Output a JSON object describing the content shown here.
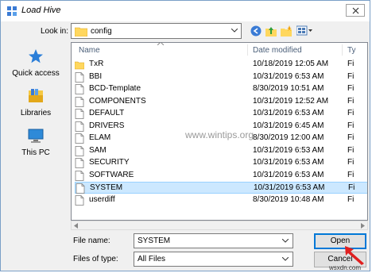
{
  "window": {
    "title": "Load Hive"
  },
  "lookin": {
    "label": "Look in:",
    "value": "config"
  },
  "places": [
    {
      "label": "Quick access",
      "icon": "star-icon"
    },
    {
      "label": "Libraries",
      "icon": "libraries-icon"
    },
    {
      "label": "This PC",
      "icon": "computer-icon"
    }
  ],
  "columns": {
    "name": "Name",
    "date": "Date modified",
    "type": "Ty"
  },
  "files": [
    {
      "name": "TxR",
      "date": "10/18/2019 12:05 AM",
      "type": "Fi",
      "kind": "folder"
    },
    {
      "name": "BBI",
      "date": "10/31/2019 6:53 AM",
      "type": "Fi",
      "kind": "file"
    },
    {
      "name": "BCD-Template",
      "date": "8/30/2019 10:51 AM",
      "type": "Fi",
      "kind": "file"
    },
    {
      "name": "COMPONENTS",
      "date": "10/31/2019 12:52 AM",
      "type": "Fi",
      "kind": "file"
    },
    {
      "name": "DEFAULT",
      "date": "10/31/2019 6:53 AM",
      "type": "Fi",
      "kind": "file"
    },
    {
      "name": "DRIVERS",
      "date": "10/31/2019 6:45 AM",
      "type": "Fi",
      "kind": "file"
    },
    {
      "name": "ELAM",
      "date": "8/30/2019 12:00 AM",
      "type": "Fi",
      "kind": "file"
    },
    {
      "name": "SAM",
      "date": "10/31/2019 6:53 AM",
      "type": "Fi",
      "kind": "file"
    },
    {
      "name": "SECURITY",
      "date": "10/31/2019 6:53 AM",
      "type": "Fi",
      "kind": "file"
    },
    {
      "name": "SOFTWARE",
      "date": "10/31/2019 6:53 AM",
      "type": "Fi",
      "kind": "file"
    },
    {
      "name": "SYSTEM",
      "date": "10/31/2019 6:53 AM",
      "type": "Fi",
      "kind": "file",
      "selected": true
    },
    {
      "name": "userdiff",
      "date": "8/30/2019 10:48 AM",
      "type": "Fi",
      "kind": "file"
    }
  ],
  "watermark": "www.wintips.org",
  "filename": {
    "label": "File name:",
    "value": "SYSTEM"
  },
  "filetype": {
    "label": "Files of type:",
    "value": "All Files"
  },
  "buttons": {
    "open": "Open",
    "cancel": "Cancel"
  },
  "brand": "wsxdn.com",
  "colors": {
    "selection": "#cce8ff",
    "accent": "#0078d7",
    "folder": "#ffd75e",
    "arrow": "#e02020"
  }
}
